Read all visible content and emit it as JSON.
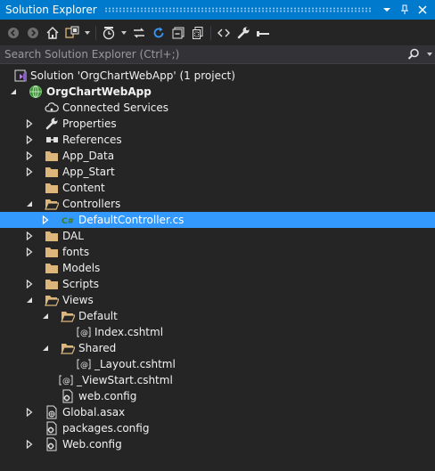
{
  "window": {
    "title": "Solution Explorer"
  },
  "search": {
    "placeholder": "Search Solution Explorer (Ctrl+;)"
  },
  "colors": {
    "accent": "#007acc",
    "selection": "#3399ff",
    "folder": "#dcb67a",
    "background": "#252526"
  },
  "tree": {
    "solution": "Solution 'OrgChartWebApp' (1 project)",
    "project": "OrgChartWebApp",
    "connected_services": "Connected Services",
    "properties": "Properties",
    "references": "References",
    "app_data": "App_Data",
    "app_start": "App_Start",
    "content": "Content",
    "controllers": "Controllers",
    "default_controller": "DefaultController.cs",
    "dal": "DAL",
    "fonts": "fonts",
    "models": "Models",
    "scripts": "Scripts",
    "views": "Views",
    "default_folder": "Default",
    "index_cshtml": "Index.cshtml",
    "shared_folder": "Shared",
    "layout_cshtml": "_Layout.cshtml",
    "viewstart_cshtml": "_ViewStart.cshtml",
    "views_web_config": "web.config",
    "global_asax": "Global.asax",
    "packages_config": "packages.config",
    "web_config": "Web.config"
  }
}
